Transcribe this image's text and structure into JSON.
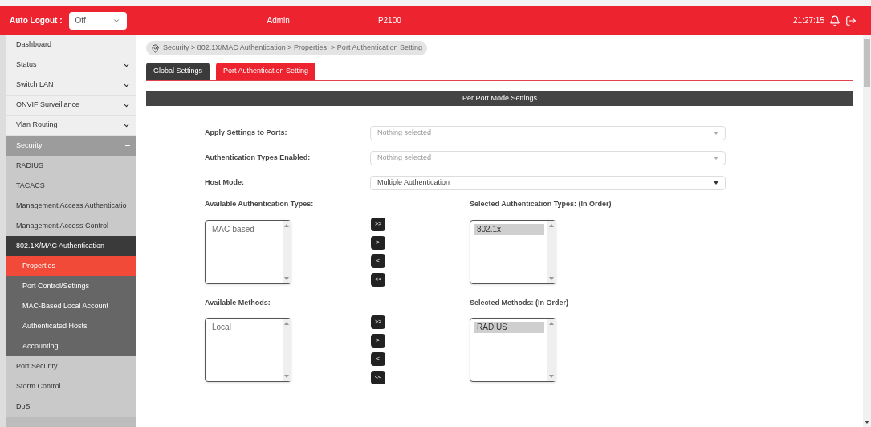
{
  "header": {
    "auto_logout_label": "Auto Logout :",
    "auto_logout_value": "Off",
    "user": "Admin",
    "model": "P2100",
    "time": "21:27:15"
  },
  "sidebar": {
    "items": [
      {
        "label": "Dashboard",
        "kind": "top",
        "selected": false
      },
      {
        "label": "Status",
        "kind": "top",
        "expanded": false,
        "selected": false
      },
      {
        "label": "Switch LAN",
        "kind": "top",
        "expanded": false,
        "selected": false
      },
      {
        "label": "ONVIF Surveillance",
        "kind": "top",
        "expanded": false,
        "selected": false
      },
      {
        "label": "Vlan Routing",
        "kind": "top",
        "expanded": false,
        "selected": false
      },
      {
        "label": "Security",
        "kind": "top",
        "expanded": true,
        "selected": true,
        "children": [
          {
            "label": "RADIUS",
            "kind": "sub",
            "selected": false
          },
          {
            "label": "TACACS+",
            "kind": "sub",
            "selected": false
          },
          {
            "label": "Management Access Authenticatio",
            "kind": "sub",
            "selected": false
          },
          {
            "label": "Management Access Control",
            "kind": "sub",
            "selected": false
          },
          {
            "label": "802.1X/MAC Authentication",
            "kind": "sub",
            "expanded": true,
            "selected": true,
            "children": [
              {
                "label": "Properties",
                "kind": "leaf",
                "selected": true
              },
              {
                "label": "Port Control/Settings",
                "kind": "leaf",
                "selected": false
              },
              {
                "label": "MAC-Based Local Account",
                "kind": "leaf",
                "selected": false
              },
              {
                "label": "Authenticated Hosts",
                "kind": "leaf",
                "selected": false
              },
              {
                "label": "Accounting",
                "kind": "leaf",
                "selected": false
              }
            ]
          },
          {
            "label": "Port Security",
            "kind": "sub",
            "selected": false
          },
          {
            "label": "Storm Control",
            "kind": "sub",
            "selected": false
          },
          {
            "label": "DoS",
            "kind": "sub",
            "selected": false
          }
        ]
      }
    ]
  },
  "breadcrumb": "Security > 802.1X/MAC Authentication > Properties  > Port Authentication Setting",
  "tabs": [
    {
      "label": "Global Settings",
      "selected": false
    },
    {
      "label": "Port Authentication Setting",
      "selected": true
    }
  ],
  "section_title": "Per Port Mode Settings",
  "fields": [
    {
      "label": "Apply Settings to Ports:",
      "placeholder": "Nothing selected"
    },
    {
      "label": "Authentication Types Enabled:",
      "placeholder": "Nothing selected"
    },
    {
      "label": "Host Mode:",
      "value": "Multiple Authentication"
    }
  ],
  "transfers": [
    {
      "available_label": "Available Authentication Types:",
      "available": [
        {
          "label": "MAC-based",
          "selected": false
        }
      ],
      "selected_label": "Selected Authentication Types: (In Order)",
      "chosen": [
        {
          "label": "802.1x",
          "selected": true
        }
      ],
      "buttons": [
        ">>",
        ">",
        "<",
        "<<"
      ]
    },
    {
      "available_label": "Available Methods:",
      "available": [
        {
          "label": "Local",
          "selected": false
        }
      ],
      "selected_label": "Selected Methods: (In Order)",
      "chosen": [
        {
          "label": "RADIUS",
          "selected": true
        }
      ],
      "buttons": [
        ">>",
        ">",
        "<",
        "<<"
      ]
    }
  ]
}
